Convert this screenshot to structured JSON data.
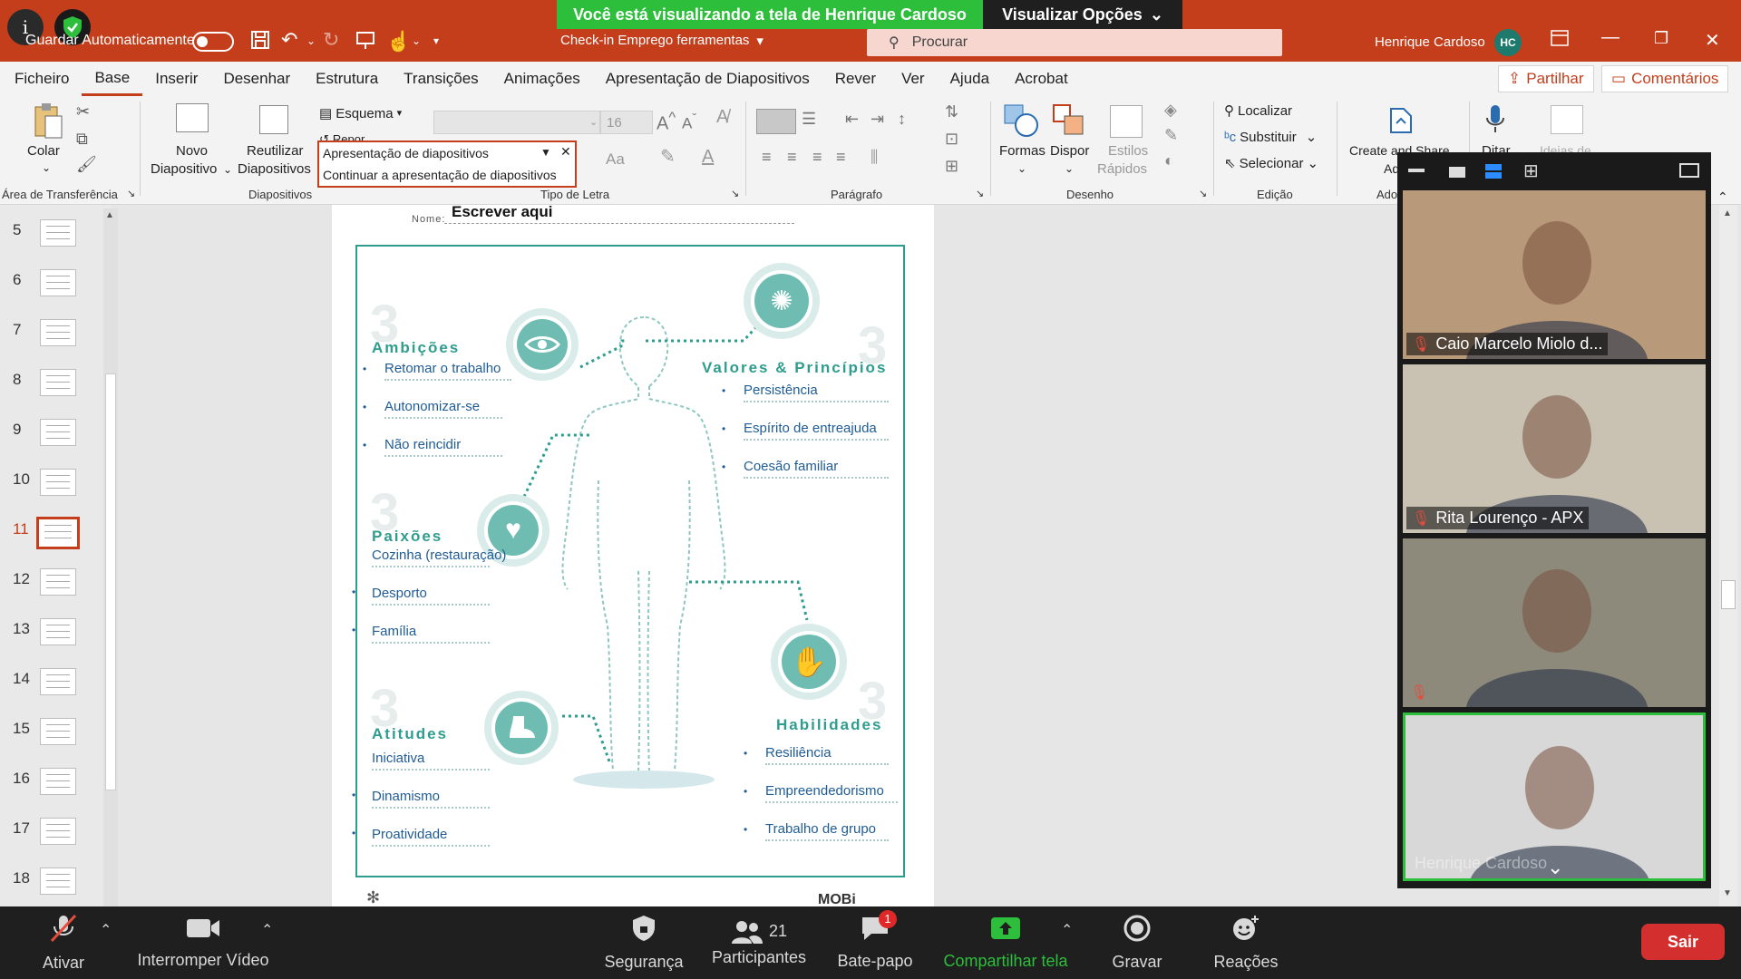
{
  "titlebar": {
    "autosave_label": "Guardar Automaticamente",
    "doc_title": "Check-in Emprego ferramentas",
    "search_placeholder": "Procurar",
    "user_name": "Henrique Cardoso",
    "user_initials": "HC"
  },
  "zoom_banner": {
    "sharing_text": "Você está visualizando a tela de Henrique Cardoso",
    "view_options": "Visualizar Opções"
  },
  "tabs": [
    "Ficheiro",
    "Base",
    "Inserir",
    "Desenhar",
    "Estrutura",
    "Transições",
    "Animações",
    "Apresentação de Diapositivos",
    "Rever",
    "Ver",
    "Ajuda",
    "Acrobat"
  ],
  "tabs_active": "Base",
  "share_button": "Partilhar",
  "comments_button": "Comentários",
  "ribbon": {
    "paste": "Colar",
    "clipboard_group": "Área de Transferência",
    "new_slide_1": "Novo",
    "new_slide_2": "Diapositivo",
    "reuse_1": "Reutilizar",
    "reuse_2": "Diapositivos",
    "layout": "Esquema",
    "reset": "Repor",
    "slides_group": "Diapositivos",
    "font_size": "16",
    "font_group": "Tipo de Letra",
    "paragraph_group": "Parágrafo",
    "shapes": "Formas",
    "arrange": "Dispor",
    "quick_styles_1": "Estilos",
    "quick_styles_2": "Rápidos",
    "drawing_group": "Desenho",
    "find": "Localizar",
    "replace": "Substituir",
    "select": "Selecionar",
    "editing_group": "Edição",
    "create_share_1": "Create and Share",
    "create_share_2": "Adob",
    "adobe_group": "Adobe",
    "dictate": "Ditar",
    "design_ideas": "Ideias de"
  },
  "popup": {
    "item1": "Apresentação de diapositivos",
    "item2": "Continuar a apresentação de diapositivos"
  },
  "slides": [
    {
      "num": "5"
    },
    {
      "num": "6"
    },
    {
      "num": "7"
    },
    {
      "num": "8"
    },
    {
      "num": "9"
    },
    {
      "num": "10"
    },
    {
      "num": "11"
    },
    {
      "num": "12"
    },
    {
      "num": "13"
    },
    {
      "num": "14"
    },
    {
      "num": "15"
    },
    {
      "num": "16"
    },
    {
      "num": "17"
    },
    {
      "num": "18"
    }
  ],
  "selected_slide": "11",
  "slide": {
    "name_label": "Nome:",
    "write_here": "Escrever aqui",
    "big_number": "3",
    "ambicoes": {
      "title": "Ambições",
      "items": [
        "Retomar o trabalho",
        "Autonomizar-se",
        "Não reincidir"
      ]
    },
    "valores": {
      "title": "Valores & Princípios",
      "items": [
        "Persistência",
        "Espírito de entreajuda",
        "Coesão familiar"
      ]
    },
    "paixoes": {
      "title": "Paixões",
      "items": [
        "Cozinha (restauração)",
        "Desporto",
        "Família"
      ]
    },
    "habilidades": {
      "title": "Habilidades",
      "items": [
        "Resiliência",
        "Empreendedorismo",
        "Trabalho de grupo"
      ]
    },
    "atitudes": {
      "title": "Atitudes",
      "items": [
        "Iniciativa",
        "Dinamismo",
        "Proatividade"
      ]
    },
    "footer_logo": "MOBi"
  },
  "participants_gallery": [
    {
      "name": "Caio Marcelo Miolo d...",
      "bg": "#b89a7a"
    },
    {
      "name": "Rita Lourenço - APX",
      "bg": "#c9c2b3"
    },
    {
      "name": "",
      "bg": "#8d8a7c"
    },
    {
      "name": "Henrique Cardoso",
      "bg": "#d8d8d8"
    }
  ],
  "zoom_toolbar": {
    "mute": "Ativar",
    "video": "Interromper Vídeo",
    "security": "Segurança",
    "participants": "Participantes",
    "participants_count": "21",
    "chat": "Bate-papo",
    "chat_badge": "1",
    "share": "Compartilhar tela",
    "record": "Gravar",
    "reactions": "Reações",
    "leave": "Sair"
  },
  "colors": {
    "ppt_red": "#c43e1c",
    "teal": "#2f9d8e",
    "zoom_green": "#2dbe3c",
    "leave_red": "#d32f2f"
  }
}
